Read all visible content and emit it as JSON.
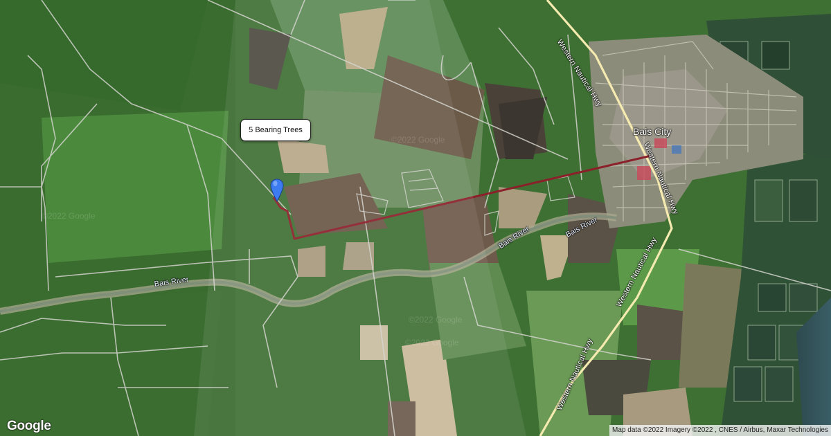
{
  "marker": {
    "tooltip_text": "5 Bearing Trees",
    "icon": "map-pin-icon",
    "color": "#3d7bf0"
  },
  "places": {
    "city": "Bais City",
    "river_1": "Bais River",
    "river_2": "Bais River",
    "river_3": "Bais River"
  },
  "roads": {
    "highway_north": "Western Nautical Hwy",
    "highway_mid": "Western Nautical Hwy",
    "highway_south": "Western Nautical Hwy"
  },
  "watermarks": [
    "©2022 Google",
    "©2022 Google",
    "©2022 Google",
    "©2022 Google"
  ],
  "footer": {
    "logo": "Google",
    "attribution": "Map data ©2022 Imagery ©2022 , CNES / Airbus, Maxar Technologies"
  },
  "colors": {
    "route": "#8b1f2a",
    "highway": "#f2e6a8",
    "road": "#d9d9d9"
  }
}
